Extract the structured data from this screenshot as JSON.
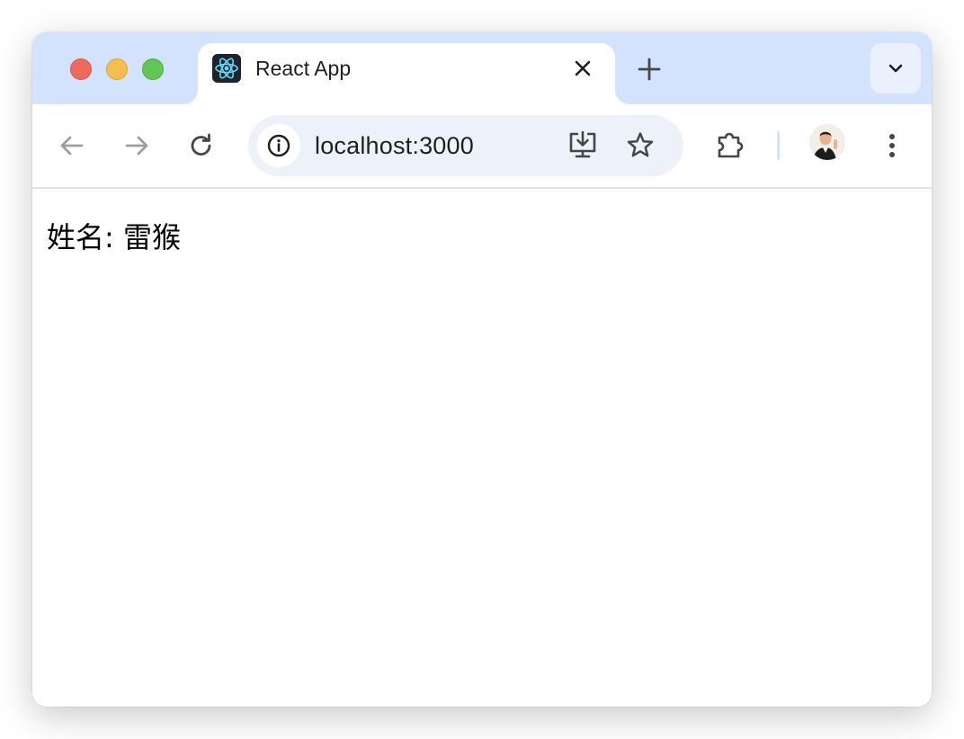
{
  "window": {
    "controls": [
      "close",
      "minimize",
      "zoom"
    ]
  },
  "tab": {
    "title": "React App",
    "favicon": "react-logo-icon"
  },
  "toolbar": {
    "back": "arrow-left-icon",
    "forward": "arrow-right-icon",
    "reload": "reload-icon",
    "url": "localhost:3000",
    "site_info": "info-icon",
    "install": "install-app-icon",
    "bookmark": "star-icon",
    "extensions": "puzzle-icon",
    "menu": "more-vert-icon"
  },
  "page": {
    "text": "姓名: 雷猴"
  },
  "colors": {
    "tabstrip": "#d3e3fd",
    "omnibox": "#edf2fa",
    "close": "#ee6a5f",
    "minimize": "#f5be4f",
    "zoom": "#62c655"
  }
}
